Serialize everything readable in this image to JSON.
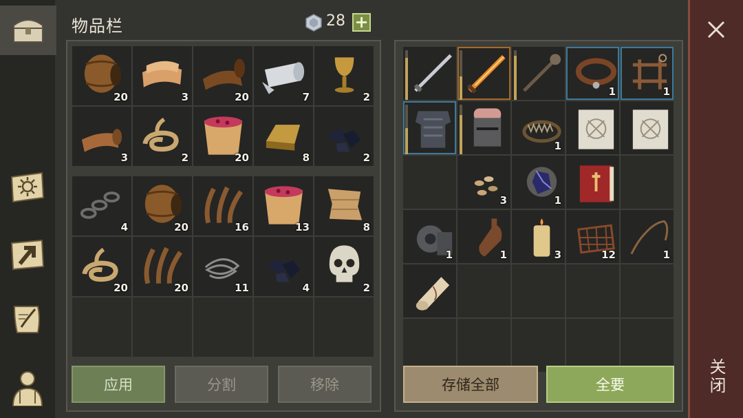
{
  "header": {
    "title": "物品栏",
    "gem_count": "28",
    "add_label": "+"
  },
  "sidebar": [
    {
      "name": "inventory-chest-icon",
      "active": true
    },
    {
      "name": "day-sun-map-icon",
      "active": false
    },
    {
      "name": "crafting-arrow-icon",
      "active": false
    },
    {
      "name": "quest-scroll-icon",
      "active": false
    },
    {
      "name": "character-icon",
      "active": false
    }
  ],
  "inventory": {
    "grid_a": [
      {
        "item": "barrel",
        "count": "20"
      },
      {
        "item": "leather-roll",
        "count": "3"
      },
      {
        "item": "hide-scroll",
        "count": "20"
      },
      {
        "item": "cloth-roll",
        "count": "7"
      },
      {
        "item": "goblet",
        "count": "2"
      },
      {
        "item": "leather-piece",
        "count": "3"
      },
      {
        "item": "rope",
        "count": "2"
      },
      {
        "item": "berry-bucket",
        "count": "20"
      },
      {
        "item": "gold-ingot",
        "count": "8"
      },
      {
        "item": "coal",
        "count": "2"
      }
    ],
    "grid_b": [
      {
        "item": "chain",
        "count": "4"
      },
      {
        "item": "barrel",
        "count": "20"
      },
      {
        "item": "fiber",
        "count": "16"
      },
      {
        "item": "berry-bucket",
        "count": "13"
      },
      {
        "item": "torn-cloth",
        "count": "8"
      },
      {
        "item": "rope",
        "count": "20"
      },
      {
        "item": "fiber",
        "count": "20"
      },
      {
        "item": "wire",
        "count": "11"
      },
      {
        "item": "coal",
        "count": "4"
      },
      {
        "item": "skull",
        "count": "2"
      },
      {
        "item": "",
        "count": ""
      },
      {
        "item": "",
        "count": ""
      },
      {
        "item": "",
        "count": ""
      },
      {
        "item": "",
        "count": ""
      },
      {
        "item": "",
        "count": ""
      }
    ],
    "buttons": {
      "apply": "应用",
      "split": "分割",
      "remove": "移除"
    }
  },
  "storage": {
    "grid": [
      {
        "item": "sword",
        "count": "",
        "dur": 0.85
      },
      {
        "item": "flame-sword",
        "count": "",
        "dur": 0.5,
        "frame": "gold"
      },
      {
        "item": "mace",
        "count": "",
        "dur": 0.9
      },
      {
        "item": "collar",
        "count": "1",
        "frame": "eq"
      },
      {
        "item": "harness",
        "count": "1",
        "frame": "eq"
      },
      {
        "item": "armor",
        "count": "",
        "dur": 0.55,
        "frame": "eq"
      },
      {
        "item": "helmet",
        "count": "",
        "dur": 0.8
      },
      {
        "item": "bear-trap",
        "count": "1"
      },
      {
        "item": "blueprint",
        "count": ""
      },
      {
        "item": "blueprint",
        "count": ""
      },
      {
        "item": "",
        "count": ""
      },
      {
        "item": "seeds",
        "count": "3"
      },
      {
        "item": "crystal",
        "count": "1"
      },
      {
        "item": "book",
        "count": ""
      },
      {
        "item": "",
        "count": ""
      },
      {
        "item": "gear",
        "count": "1"
      },
      {
        "item": "bottle",
        "count": "1"
      },
      {
        "item": "candle",
        "count": "3"
      },
      {
        "item": "net",
        "count": "12"
      },
      {
        "item": "whip",
        "count": "1"
      },
      {
        "item": "scroll",
        "count": ""
      },
      {
        "item": "",
        "count": ""
      },
      {
        "item": "",
        "count": ""
      },
      {
        "item": "",
        "count": ""
      },
      {
        "item": "",
        "count": ""
      },
      {
        "item": "",
        "count": ""
      },
      {
        "item": "",
        "count": ""
      },
      {
        "item": "",
        "count": ""
      },
      {
        "item": "",
        "count": ""
      },
      {
        "item": "",
        "count": ""
      }
    ],
    "buttons": {
      "store_all": "存储全部",
      "take_all": "全要"
    }
  },
  "close": {
    "label": "关闭"
  },
  "colors": {
    "panel": "#3e3e39",
    "cell": "#252523",
    "accent_green": "#8da85a",
    "close_strip": "#4f2b28"
  }
}
